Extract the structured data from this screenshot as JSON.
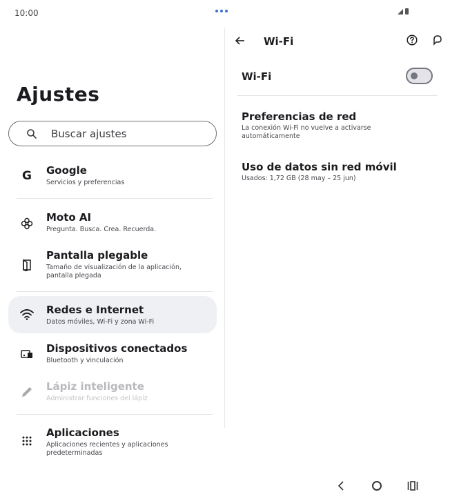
{
  "status": {
    "time": "10:00"
  },
  "left": {
    "title": "Ajustes",
    "search_placeholder": "Buscar ajustes",
    "items": [
      {
        "title": "Google",
        "subtitle": "Servicios y preferencias",
        "icon": "google-g-icon"
      },
      {
        "title": "Moto AI",
        "subtitle": "Pregunta. Busca. Crea. Recuerda.",
        "icon": "moto-ai-icon"
      },
      {
        "title": "Pantalla plegable",
        "subtitle": "Tamaño de visualización de la aplicación, pantalla plegada",
        "icon": "foldable-icon"
      },
      {
        "title": "Redes e Internet",
        "subtitle": "Datos móviles, Wi-Fi y zona Wi-Fi",
        "icon": "wifi-icon"
      },
      {
        "title": "Dispositivos conectados",
        "subtitle": "Bluetooth y vinculación",
        "icon": "devices-icon"
      },
      {
        "title": "Lápiz inteligente",
        "subtitle": "Administrar funciones del lápiz",
        "icon": "pen-icon"
      },
      {
        "title": "Aplicaciones",
        "subtitle": "Aplicaciones recientes y aplicaciones predeterminadas",
        "icon": "apps-grid-icon"
      }
    ]
  },
  "right": {
    "title": "Wi-Fi",
    "wifi_label": "Wi-Fi",
    "wifi_enabled": false,
    "items": [
      {
        "title": "Preferencias de red",
        "subtitle": "La conexión Wi-Fi no vuelve a activarse automáticamente"
      },
      {
        "title": "Uso de datos sin red móvil",
        "subtitle": "Usados: 1,72 GB (28 may – 25 jun)"
      }
    ]
  },
  "colors": {
    "accent_dots": "#3b6fd8",
    "active_bg": "#eef0f4",
    "text": "#1b1b1f"
  }
}
